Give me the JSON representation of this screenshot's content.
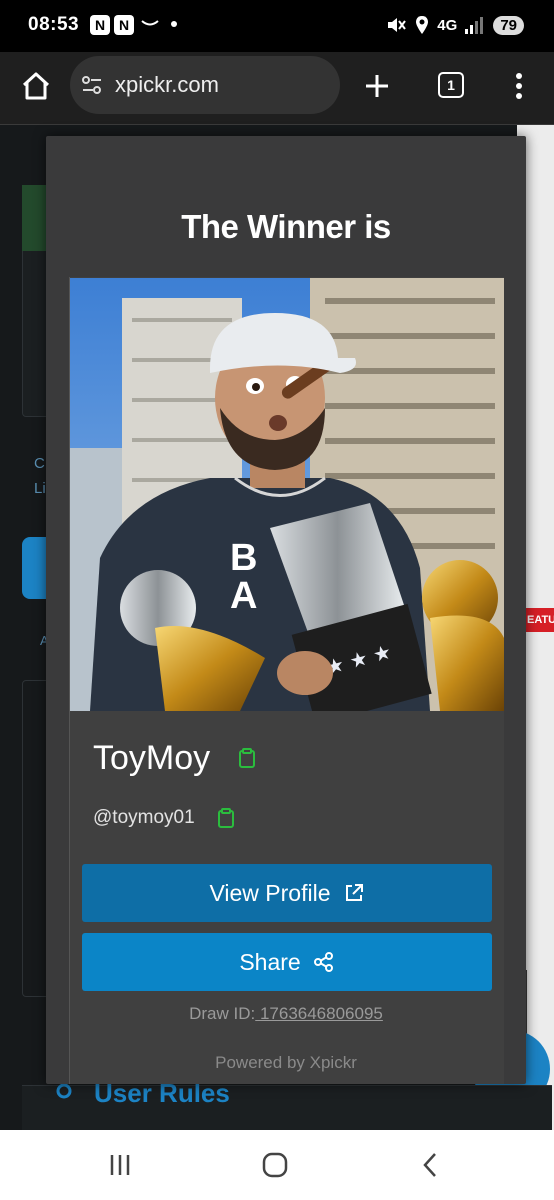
{
  "status": {
    "time": "08:53",
    "notif_icons": [
      "n-badge-icon",
      "n-badge-icon",
      "amazon-smile-icon",
      "dot-icon"
    ],
    "network": "4G",
    "battery": "79"
  },
  "browser": {
    "url": "xpickr.com",
    "tab_count": "1"
  },
  "background": {
    "fragments": [
      "C",
      "Li",
      "A"
    ],
    "badge": "EATU",
    "rules_heading": "User Rules"
  },
  "modal": {
    "title": "The Winner is",
    "winner_name": "ToyMoy",
    "winner_handle": "@toymoy01",
    "view_profile_label": "View Profile",
    "share_label": "Share",
    "draw_id_label": "Draw ID:",
    "draw_id_value": " 1763646806095",
    "powered_by": "Powered by Xpickr"
  },
  "colors": {
    "accent_copy": "#2bbd3e",
    "view_profile_bg": "#0e6ea6",
    "share_bg": "#0b85c7",
    "modal_bg": "#3a3a3b"
  }
}
